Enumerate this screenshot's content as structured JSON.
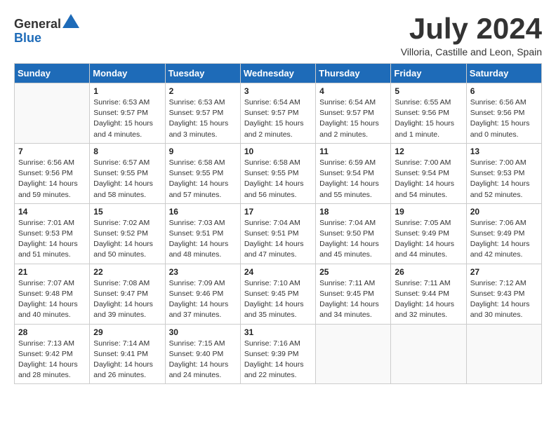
{
  "logo": {
    "general": "General",
    "blue": "Blue"
  },
  "title": "July 2024",
  "location": "Villoria, Castille and Leon, Spain",
  "weekdays": [
    "Sunday",
    "Monday",
    "Tuesday",
    "Wednesday",
    "Thursday",
    "Friday",
    "Saturday"
  ],
  "weeks": [
    [
      {
        "day": "",
        "sunrise": "",
        "sunset": "",
        "daylight": ""
      },
      {
        "day": "1",
        "sunrise": "6:53 AM",
        "sunset": "9:57 PM",
        "daylight": "15 hours and 4 minutes."
      },
      {
        "day": "2",
        "sunrise": "6:53 AM",
        "sunset": "9:57 PM",
        "daylight": "15 hours and 3 minutes."
      },
      {
        "day": "3",
        "sunrise": "6:54 AM",
        "sunset": "9:57 PM",
        "daylight": "15 hours and 2 minutes."
      },
      {
        "day": "4",
        "sunrise": "6:54 AM",
        "sunset": "9:57 PM",
        "daylight": "15 hours and 2 minutes."
      },
      {
        "day": "5",
        "sunrise": "6:55 AM",
        "sunset": "9:56 PM",
        "daylight": "15 hours and 1 minute."
      },
      {
        "day": "6",
        "sunrise": "6:56 AM",
        "sunset": "9:56 PM",
        "daylight": "15 hours and 0 minutes."
      }
    ],
    [
      {
        "day": "7",
        "sunrise": "6:56 AM",
        "sunset": "9:56 PM",
        "daylight": "14 hours and 59 minutes."
      },
      {
        "day": "8",
        "sunrise": "6:57 AM",
        "sunset": "9:55 PM",
        "daylight": "14 hours and 58 minutes."
      },
      {
        "day": "9",
        "sunrise": "6:58 AM",
        "sunset": "9:55 PM",
        "daylight": "14 hours and 57 minutes."
      },
      {
        "day": "10",
        "sunrise": "6:58 AM",
        "sunset": "9:55 PM",
        "daylight": "14 hours and 56 minutes."
      },
      {
        "day": "11",
        "sunrise": "6:59 AM",
        "sunset": "9:54 PM",
        "daylight": "14 hours and 55 minutes."
      },
      {
        "day": "12",
        "sunrise": "7:00 AM",
        "sunset": "9:54 PM",
        "daylight": "14 hours and 54 minutes."
      },
      {
        "day": "13",
        "sunrise": "7:00 AM",
        "sunset": "9:53 PM",
        "daylight": "14 hours and 52 minutes."
      }
    ],
    [
      {
        "day": "14",
        "sunrise": "7:01 AM",
        "sunset": "9:53 PM",
        "daylight": "14 hours and 51 minutes."
      },
      {
        "day": "15",
        "sunrise": "7:02 AM",
        "sunset": "9:52 PM",
        "daylight": "14 hours and 50 minutes."
      },
      {
        "day": "16",
        "sunrise": "7:03 AM",
        "sunset": "9:51 PM",
        "daylight": "14 hours and 48 minutes."
      },
      {
        "day": "17",
        "sunrise": "7:04 AM",
        "sunset": "9:51 PM",
        "daylight": "14 hours and 47 minutes."
      },
      {
        "day": "18",
        "sunrise": "7:04 AM",
        "sunset": "9:50 PM",
        "daylight": "14 hours and 45 minutes."
      },
      {
        "day": "19",
        "sunrise": "7:05 AM",
        "sunset": "9:49 PM",
        "daylight": "14 hours and 44 minutes."
      },
      {
        "day": "20",
        "sunrise": "7:06 AM",
        "sunset": "9:49 PM",
        "daylight": "14 hours and 42 minutes."
      }
    ],
    [
      {
        "day": "21",
        "sunrise": "7:07 AM",
        "sunset": "9:48 PM",
        "daylight": "14 hours and 40 minutes."
      },
      {
        "day": "22",
        "sunrise": "7:08 AM",
        "sunset": "9:47 PM",
        "daylight": "14 hours and 39 minutes."
      },
      {
        "day": "23",
        "sunrise": "7:09 AM",
        "sunset": "9:46 PM",
        "daylight": "14 hours and 37 minutes."
      },
      {
        "day": "24",
        "sunrise": "7:10 AM",
        "sunset": "9:45 PM",
        "daylight": "14 hours and 35 minutes."
      },
      {
        "day": "25",
        "sunrise": "7:11 AM",
        "sunset": "9:45 PM",
        "daylight": "14 hours and 34 minutes."
      },
      {
        "day": "26",
        "sunrise": "7:11 AM",
        "sunset": "9:44 PM",
        "daylight": "14 hours and 32 minutes."
      },
      {
        "day": "27",
        "sunrise": "7:12 AM",
        "sunset": "9:43 PM",
        "daylight": "14 hours and 30 minutes."
      }
    ],
    [
      {
        "day": "28",
        "sunrise": "7:13 AM",
        "sunset": "9:42 PM",
        "daylight": "14 hours and 28 minutes."
      },
      {
        "day": "29",
        "sunrise": "7:14 AM",
        "sunset": "9:41 PM",
        "daylight": "14 hours and 26 minutes."
      },
      {
        "day": "30",
        "sunrise": "7:15 AM",
        "sunset": "9:40 PM",
        "daylight": "14 hours and 24 minutes."
      },
      {
        "day": "31",
        "sunrise": "7:16 AM",
        "sunset": "9:39 PM",
        "daylight": "14 hours and 22 minutes."
      },
      {
        "day": "",
        "sunrise": "",
        "sunset": "",
        "daylight": ""
      },
      {
        "day": "",
        "sunrise": "",
        "sunset": "",
        "daylight": ""
      },
      {
        "day": "",
        "sunrise": "",
        "sunset": "",
        "daylight": ""
      }
    ]
  ]
}
